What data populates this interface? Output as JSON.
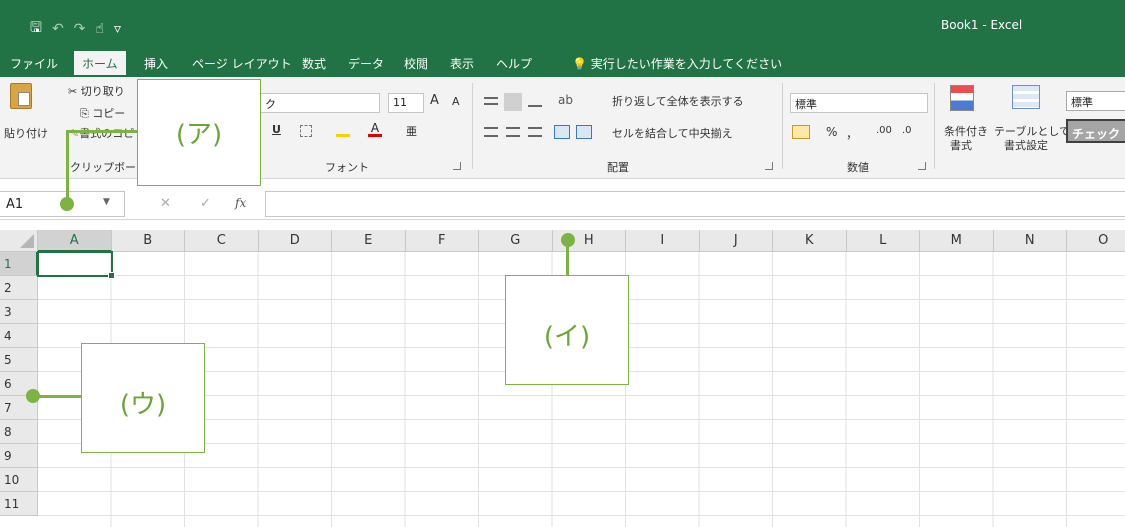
{
  "window": {
    "title": "Book1  -  Excel"
  },
  "qat": {
    "save_glyph": "🖫",
    "undo_glyph": "↶",
    "redo_glyph": "↷",
    "touch_glyph": "☝",
    "more_glyph": "▿"
  },
  "tabs": [
    {
      "label": "ファイル"
    },
    {
      "label": "ホーム"
    },
    {
      "label": "挿入"
    },
    {
      "label": "ページ レイアウト"
    },
    {
      "label": "数式"
    },
    {
      "label": "データ"
    },
    {
      "label": "校閲"
    },
    {
      "label": "表示"
    },
    {
      "label": "ヘルプ"
    }
  ],
  "tellme": {
    "icon": "💡",
    "label": "実行したい作業を入力してください"
  },
  "ribbon": {
    "clipboard": {
      "paste": "貼り付け",
      "cut": "切り取り",
      "copy": "コピー",
      "format_painter": "書式のコピ",
      "group": "クリップボード"
    },
    "font": {
      "font_name": "ク",
      "font_size": "11",
      "grow": "A",
      "shrink": "A",
      "underline": "U",
      "group": "フォント"
    },
    "alignment": {
      "wrap": "折り返して全体を表示する",
      "merge": "セルを結合して中央揃え",
      "group": "配置"
    },
    "number": {
      "format": "標準",
      "percent": "%",
      "comma": "，",
      "inc_dec": ".00",
      "dec_dec": ".0",
      "group": "数値"
    },
    "styles": {
      "conditional_1": "条件付き",
      "conditional_2": "書式",
      "table_1": "テーブルとして",
      "table_2": "書式設定",
      "normal": "標準",
      "check": "チェック"
    }
  },
  "formula_bar": {
    "namebox": "A1",
    "cancel": "✕",
    "enter": "✓",
    "fx": "fx",
    "value": ""
  },
  "grid": {
    "columns": [
      "A",
      "B",
      "C",
      "D",
      "E",
      "F",
      "G",
      "H",
      "I",
      "J",
      "K",
      "L",
      "M",
      "N",
      "O"
    ],
    "rows": [
      "1",
      "2",
      "3",
      "4",
      "5",
      "6",
      "7",
      "8",
      "9",
      "10",
      "11"
    ],
    "active_cell": "A1"
  },
  "callouts": {
    "a": "(ア)",
    "b": "(イ)",
    "c": "(ウ)"
  },
  "colors": {
    "accent": "#217346",
    "callout": "#7cb342"
  }
}
